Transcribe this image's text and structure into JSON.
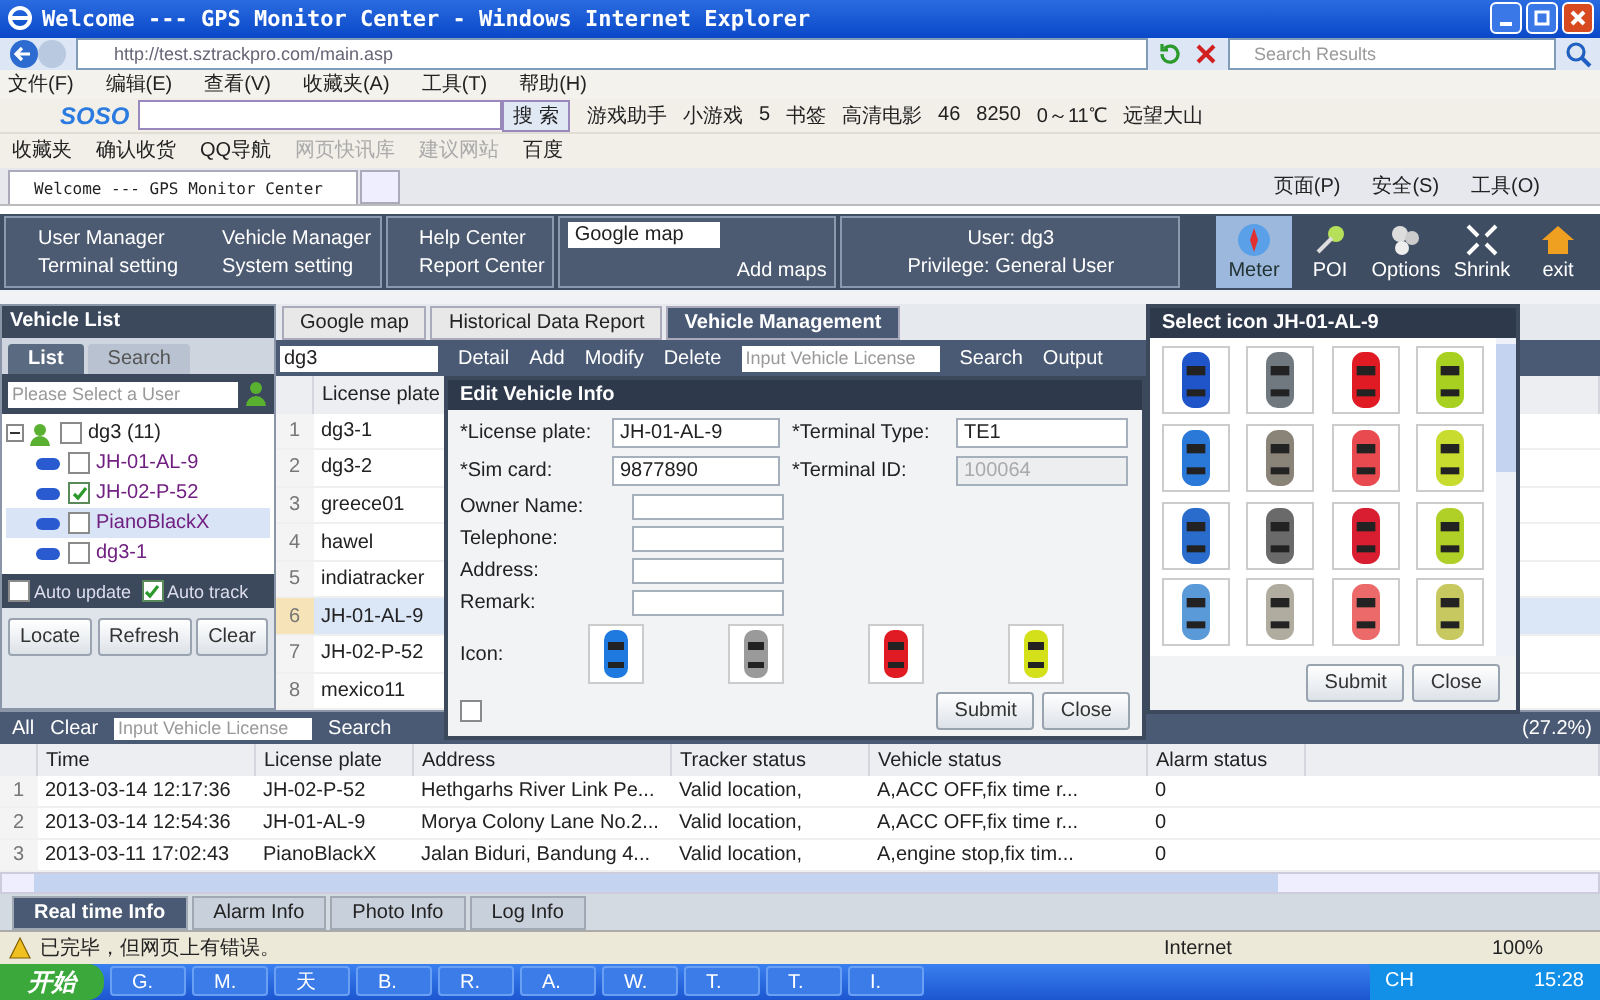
{
  "window": {
    "title": "Welcome --- GPS Monitor Center - Windows Internet Explorer"
  },
  "address_bar": {
    "value": "http://test.sztrackpro.com/main.asp"
  },
  "search_box": {
    "placeholder": "Search Results"
  },
  "menu_bar": [
    "文件(F)",
    "编辑(E)",
    "查看(V)",
    "收藏夹(A)",
    "工具(T)",
    "帮助(H)"
  ],
  "soso_toolbar": {
    "logo": "SOSO",
    "search_button": "搜 索",
    "items": [
      "游戏助手",
      "小游戏",
      "5",
      "书签",
      "高清电影",
      "46",
      "8250",
      "0～11℃",
      "远望大山"
    ]
  },
  "favorites_bar": [
    {
      "label": "收藏夹",
      "disabled": false
    },
    {
      "label": "确认收货",
      "disabled": false
    },
    {
      "label": "QQ导航",
      "disabled": false
    },
    {
      "label": "网页快讯库",
      "disabled": true
    },
    {
      "label": "建议网站",
      "disabled": true
    },
    {
      "label": "百度",
      "disabled": false
    }
  ],
  "browser_tab": {
    "title": "Welcome --- GPS Monitor Center"
  },
  "command_bar": [
    "页面(P)",
    "安全(S)",
    "工具(O)"
  ],
  "app_toolbar": {
    "menus": [
      "User Manager",
      "Vehicle Manager",
      "Terminal setting",
      "System setting"
    ],
    "help_menus": [
      "Help Center",
      "Report Center"
    ],
    "map_select": "Google map",
    "add_maps": "Add maps",
    "user": "User: dg3",
    "privilege": "Privilege: General User",
    "tools": [
      {
        "label": "Meter",
        "kind": "compass",
        "selected": true
      },
      {
        "label": "POI",
        "kind": "pin",
        "selected": false
      },
      {
        "label": "Options",
        "kind": "gears",
        "selected": false
      },
      {
        "label": "Shrink",
        "kind": "arrows",
        "selected": false
      },
      {
        "label": "exit",
        "kind": "house",
        "selected": false
      }
    ]
  },
  "vehicle_list": {
    "title": "Vehicle List",
    "tabs": [
      {
        "label": "List",
        "selected": true
      },
      {
        "label": "Search",
        "selected": false
      }
    ],
    "user_select": {
      "placeholder": "Please Select a User"
    },
    "tree": {
      "label": "dg3 (11)",
      "checked": false,
      "expanded": true,
      "children": [
        {
          "label": "JH-01-AL-9",
          "checked": false,
          "selected": false
        },
        {
          "label": "JH-02-P-52",
          "checked": true,
          "selected": false
        },
        {
          "label": "PianoBlackX",
          "checked": false,
          "selected": true
        },
        {
          "label": "dg3-1",
          "checked": false,
          "selected": false
        }
      ]
    },
    "options": [
      {
        "label": "Auto update",
        "checked": false
      },
      {
        "label": "Auto track",
        "checked": true
      }
    ],
    "buttons": [
      "Locate",
      "Refresh",
      "Clear"
    ]
  },
  "center": {
    "tabs": [
      {
        "label": "Google map",
        "selected": false
      },
      {
        "label": "Historical Data Report",
        "selected": false
      },
      {
        "label": "Vehicle Management",
        "selected": true
      }
    ],
    "user_select": "dg3",
    "actions": [
      "Detail",
      "Add",
      "Modify",
      "Delete"
    ],
    "search": {
      "placeholder": "Input Vehicle License"
    },
    "search_button": "Search",
    "output_button": "Output",
    "table": {
      "columns": [
        "License plate"
      ],
      "rows": [
        {
          "no": "1",
          "plate": "dg3-1",
          "selected": false
        },
        {
          "no": "2",
          "plate": "dg3-2",
          "selected": false
        },
        {
          "no": "3",
          "plate": "greece01",
          "selected": false
        },
        {
          "no": "4",
          "plate": "hawel",
          "selected": false
        },
        {
          "no": "5",
          "plate": "indiatracker",
          "selected": false
        },
        {
          "no": "6",
          "plate": "JH-01-AL-9",
          "selected": true
        },
        {
          "no": "7",
          "plate": "JH-02-P-52",
          "selected": false
        },
        {
          "no": "8",
          "plate": "mexico11",
          "selected": false
        }
      ]
    }
  },
  "edit_dialog": {
    "title": "Edit Vehicle Info",
    "fields": [
      {
        "label": "*License plate:",
        "value": "JH-01-AL-9",
        "disabled": false
      },
      {
        "label": "*Terminal Type:",
        "value": "TE1",
        "disabled": false
      },
      {
        "label": "*Sim card:",
        "value": "9877890",
        "disabled": false
      },
      {
        "label": "*Terminal ID:",
        "value": "100064",
        "disabled": true
      }
    ],
    "owner_fields": [
      "Owner Name:",
      "Telephone:",
      "Address:",
      "Remark:"
    ],
    "icon_label": "Icon:",
    "icons": [
      {
        "color": "#1f7ae0"
      },
      {
        "color": "#9a9a9a"
      },
      {
        "color": "#e01b24"
      },
      {
        "color": "#d4e01a"
      }
    ],
    "checkbox": {
      "checked": false
    },
    "buttons": [
      "Submit",
      "Close"
    ]
  },
  "icon_dialog": {
    "title": "Select icon JH-01-AL-9",
    "icons": [
      {
        "color": "#1f55c8"
      },
      {
        "color": "#707880"
      },
      {
        "color": "#e01b24"
      },
      {
        "color": "#a8d020"
      },
      {
        "color": "#2a78d8"
      },
      {
        "color": "#8a8478"
      },
      {
        "color": "#e84a50"
      },
      {
        "color": "#c8dc30"
      },
      {
        "color": "#2a6ccc"
      },
      {
        "color": "#6a6a6a"
      },
      {
        "color": "#d81e30"
      },
      {
        "color": "#b0d028"
      },
      {
        "color": "#5a9ad8"
      },
      {
        "color": "#b0aca0"
      },
      {
        "color": "#ec6a6a"
      },
      {
        "color": "#c8c860"
      }
    ],
    "buttons": [
      "Submit",
      "Close"
    ]
  },
  "bottom_panel": {
    "actions": [
      "All",
      "Clear"
    ],
    "search": {
      "placeholder": "Input Vehicle License"
    },
    "search_button": "Search",
    "progress_text": "(27.2%)",
    "table": {
      "columns": [
        "Time",
        "License plate",
        "Address",
        "Tracker status",
        "Vehicle status",
        "Alarm status"
      ],
      "rows": [
        {
          "no": "1",
          "cells": [
            "2013-03-14 12:17:36",
            "JH-02-P-52",
            "Hethgarhs River Link Pe...",
            "Valid location,",
            "A,ACC OFF,fix time r...",
            "0"
          ]
        },
        {
          "no": "2",
          "cells": [
            "2013-03-14 12:54:36",
            "JH-01-AL-9",
            "Morya Colony Lane No.2...",
            "Valid location,",
            "A,ACC OFF,fix time r...",
            "0"
          ]
        },
        {
          "no": "3",
          "cells": [
            "2013-03-11 17:02:43",
            "PianoBlackX",
            "Jalan Biduri, Bandung 4...",
            "Valid location,",
            "A,engine stop,fix tim...",
            "0"
          ]
        }
      ]
    },
    "tabs": [
      {
        "label": "Real time Info",
        "selected": true
      },
      {
        "label": "Alarm Info",
        "selected": false
      },
      {
        "label": "Photo Info",
        "selected": false
      },
      {
        "label": "Log Info",
        "selected": false
      }
    ]
  },
  "status_bar": {
    "text": "已完毕，但网页上有错误。",
    "zone": "Internet",
    "zoom": "100%"
  },
  "taskbar": {
    "start": "开始",
    "tasks": [
      "G.",
      "M.",
      "天",
      "B.",
      "R.",
      "A.",
      "W.",
      "T.",
      "T.",
      "I."
    ],
    "language": "CH",
    "clock": "15:28"
  }
}
